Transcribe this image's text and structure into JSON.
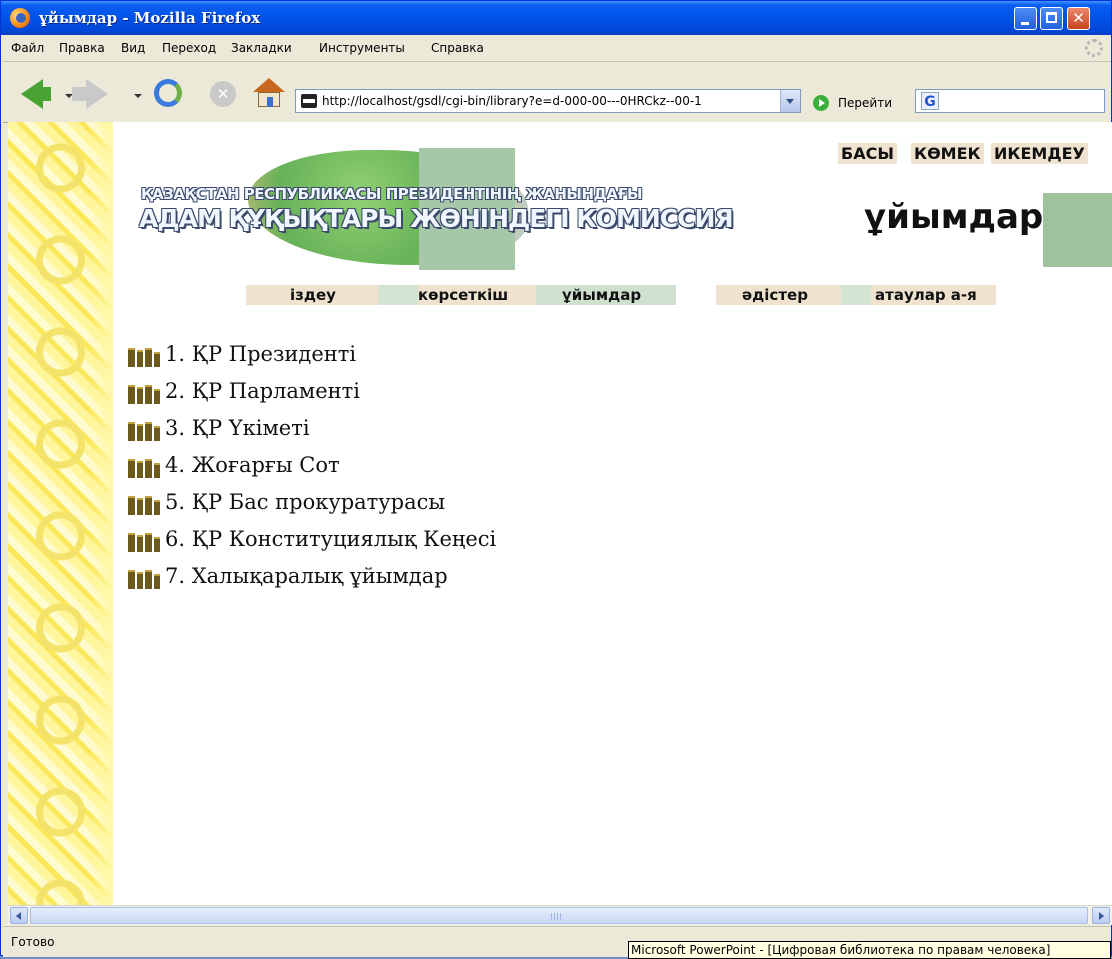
{
  "window": {
    "title": "ұйымдар - Mozilla Firefox",
    "controls": {
      "minimize": "",
      "maximize": "",
      "close": "✕"
    }
  },
  "menubar": {
    "items": [
      "Файл",
      "Правка",
      "Вид",
      "Переход",
      "Закладки",
      "Инструменты",
      "Справка"
    ]
  },
  "toolbar": {
    "url": "http://localhost/gsdl/cgi-bin/library?e=d-000-00---0HRCkz--00-1",
    "go_label": "Перейти",
    "search_value": ""
  },
  "page": {
    "banner": {
      "line1": "ҚАЗАҚСТАН РЕСПУБЛИКАСЫ ПРЕЗИДЕНТІНІҢ ЖАНЫНДАҒЫ",
      "line2": "АДАМ ҚҰҚЫҚТАРЫ ЖӨНІНДЕГІ КОМИССИЯ"
    },
    "top_links": [
      "БАСЫ",
      "КӨМЕК",
      "ИКЕМДЕУ"
    ],
    "heading": "ұйымдар",
    "nav_tabs": [
      "іздеу",
      "көрсеткіш",
      "ұйымдар",
      "әдістер",
      "атаулар а-я"
    ],
    "organizations": [
      "1. ҚР Президенті",
      "2. ҚР Парламенті",
      "3. ҚР Үкіметі",
      "4. Жоғарғы Сот",
      "5. ҚР Бас прокуратурасы",
      "6. ҚР Конституциялық Кеңесі",
      "7. Халықаралық ұйымдар"
    ]
  },
  "statusbar": {
    "status": "Готово",
    "tooltip": "Microsoft PowerPoint - [Цифровая библиотека по правам человека]"
  },
  "colors": {
    "title_bar": "#0052e8",
    "tab_accent": "#a7c8a8",
    "tab_beige": "#efe3d0",
    "ornament_yellow": "#fbe75a"
  }
}
